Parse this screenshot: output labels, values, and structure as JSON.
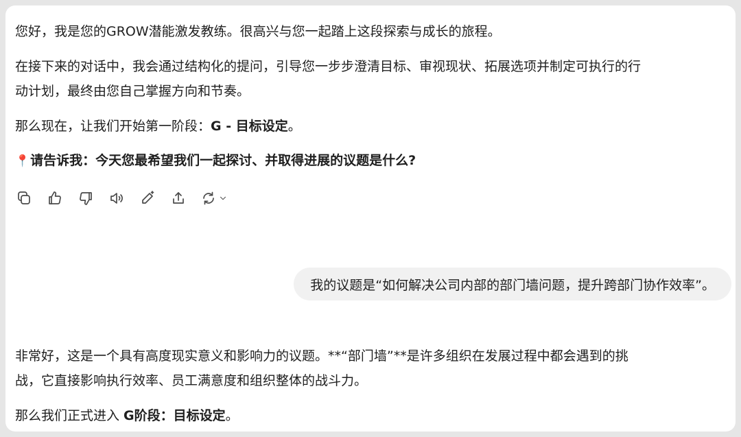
{
  "assistant_1": {
    "line1": "您好，我是您的GROW潜能激发教练。很高兴与您一起踏上这段探索与成长的旅程。",
    "line2a": "在接下来的对话中，我会通过结构化的提问，引导您一步步澄清目标、审视现状、拓展选项并制定可执行的行",
    "line2b": "动计划，最终由您自己掌握方向和节奏。",
    "line3_prefix": "那么现在，让我们开始第一阶段：",
    "line3_bold": "G - 目标设定",
    "line3_suffix": "。",
    "question_pin": "📍",
    "question": "请告诉我：今天您最希望我们一起探讨、并取得进展的议题是什么?"
  },
  "action_bar": {
    "icons": [
      "copy-icon",
      "thumbs-up-icon",
      "thumbs-down-icon",
      "read-aloud-icon",
      "edit-icon",
      "share-icon",
      "regenerate-icon",
      "chevron-down-icon"
    ]
  },
  "user_message": {
    "text": "我的议题是“如何解决公司内部的部门墙问题，提升跨部门协作效率”。"
  },
  "assistant_2": {
    "line1a": "非常好，这是一个具有高度现实意义和影响力的议题。**“部门墙”**是许多组织在发展过程中都会遇到的挑",
    "line1b": "战，它直接影响执行效率、员工满意度和组织整体的战斗力。",
    "line2_prefix": "那么我们正式进入 ",
    "line2_bold": "G阶段：目标设定",
    "line2_suffix": "。"
  },
  "colors": {
    "page_bg": "#e6e6e6",
    "card_bg": "#ffffff",
    "bubble_bg": "#f1f1f1",
    "text": "#1f1f1f",
    "icon": "#4a4a4a",
    "pin": "#e0322b"
  }
}
